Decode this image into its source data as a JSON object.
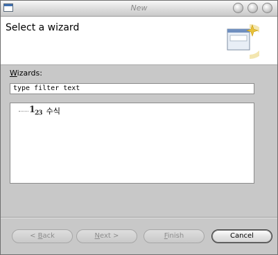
{
  "window": {
    "title": "New"
  },
  "header": {
    "title": "Select a wizard"
  },
  "wizards": {
    "label_mnemonic": "W",
    "label_rest": "izards:",
    "filter_value": "type filter text",
    "items": [
      {
        "icon_text": "1",
        "icon_sub": "23",
        "label": "수식"
      }
    ]
  },
  "buttons": {
    "back_arrow": "<",
    "back_mnemonic": "B",
    "back_rest": "ack",
    "next_mnemonic": "N",
    "next_rest": "ext",
    "next_arrow": ">",
    "finish_mnemonic": "F",
    "finish_rest": "inish",
    "cancel": "Cancel"
  },
  "colors": {
    "header_bg": "#ffffff",
    "dialog_bg": "#c8c8c8",
    "accent_star": "#e8c23a"
  }
}
